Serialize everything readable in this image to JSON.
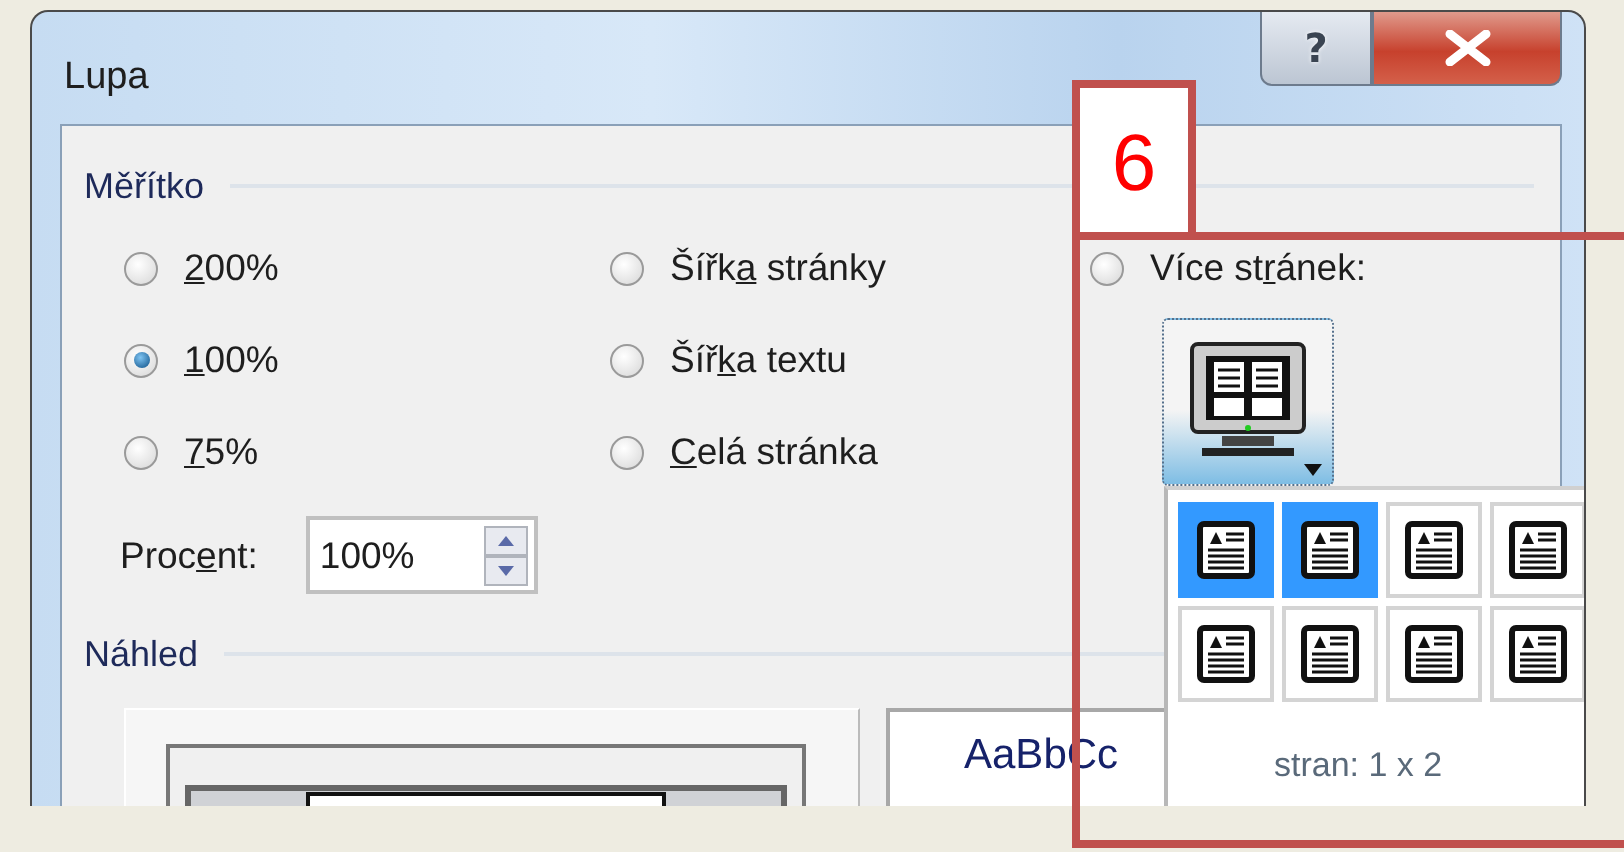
{
  "window": {
    "title": "Lupa",
    "help_button": "?"
  },
  "zoom": {
    "title": "Měřítko",
    "columns": [
      [
        {
          "label": {
            "key": "2",
            "after": "00%"
          },
          "selected": false
        },
        {
          "label": {
            "key": "1",
            "after": "00%"
          },
          "selected": true
        },
        {
          "label": {
            "key": "7",
            "after": "5%"
          },
          "selected": false
        }
      ],
      [
        {
          "label": {
            "before": "Šířk",
            "key": "a",
            "after": " stránky"
          },
          "selected": false
        },
        {
          "label": {
            "before": "Šíř",
            "key": "k",
            "after": "a textu"
          },
          "selected": false
        },
        {
          "label": {
            "key": "C",
            "after": "elá stránka"
          },
          "selected": false
        }
      ],
      [
        {
          "label": {
            "before": "Více st",
            "key": "r",
            "after": "ánek:"
          },
          "selected": false
        }
      ]
    ],
    "percent": {
      "label": {
        "before": "Proc",
        "key": "e",
        "after": "nt:"
      },
      "value": "100%"
    }
  },
  "preview": {
    "title": "Náhled",
    "sample_text": "AaBbCc"
  },
  "pages_popup": {
    "cells": [
      {
        "selected": true
      },
      {
        "selected": true
      },
      {
        "selected": false
      },
      {
        "selected": false
      },
      {
        "selected": false
      },
      {
        "selected": false
      },
      {
        "selected": false
      },
      {
        "selected": false
      }
    ],
    "caption": "stran: 1 x 2"
  },
  "annotation": {
    "label": "6"
  }
}
